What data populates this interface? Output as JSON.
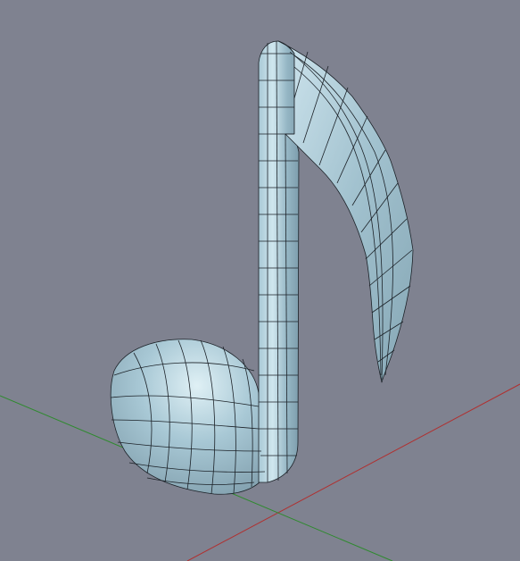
{
  "viewport": {
    "background_color": "#7f8290",
    "mesh_fill_color": "#9ebfcd",
    "mesh_highlight_color": "#d6ecf3",
    "mesh_shadow_color": "#7d9aa7",
    "wire_color": "#1c2228",
    "axis_x_color": "#b03030",
    "axis_y_color": "#2f8a2f"
  },
  "object": {
    "icon": "eighth-note-icon",
    "shading": "smooth-with-wireframe"
  }
}
